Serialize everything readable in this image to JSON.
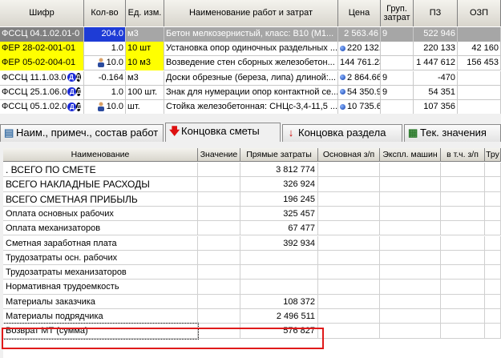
{
  "top_table": {
    "headers": [
      "Шифр",
      "Кол-во",
      "Ед. изм.",
      "Наименование работ и затрат",
      "Цена",
      "Груп. затрат",
      "ПЗ",
      "ОЗП"
    ],
    "rows": [
      {
        "code": "ФССЦ 04.1.02.01-0",
        "qty": "204.0",
        "unit": "м3",
        "name": "Бетон мелкозернистый, класс: В10 (М1...",
        "price": "2 563.46",
        "group": "9",
        "pz": "522 946",
        "ozp": "",
        "style": "selected"
      },
      {
        "code": "ФЕР 28-02-001-01",
        "qty": "1.0",
        "unit": "10 шт",
        "name": "Установка опор одиночных раздельных ...",
        "price": "220 132.71",
        "group": "",
        "pz": "220 133",
        "ozp": "42 160",
        "style": "yellow"
      },
      {
        "code": "ФЕР 05-02-004-01",
        "qty": "10.0",
        "unit": "10 м3",
        "name": "Возведение стен сборных железобетон...",
        "price": "144 761.23",
        "group": "",
        "pz": "1 447 612",
        "ozp": "156 453",
        "style": "yellow"
      },
      {
        "code": "ФССЦ 11.1.03.0",
        "qty": "-0.164",
        "unit": "м3",
        "name": "Доски обрезные (береза, липа) длиной:...",
        "price": "2 864.66",
        "group": "9",
        "pz": "-470",
        "ozp": "",
        "style": "plain"
      },
      {
        "code": "ФССЦ 25.1.06.0",
        "qty": "1.0",
        "unit": "100 шт.",
        "name": "Знак для нумерации опор контактной се...",
        "price": "54 350.99",
        "group": "9",
        "pz": "54 351",
        "ozp": "",
        "style": "plain"
      },
      {
        "code": "ФССЦ 05.1.02.0",
        "qty": "10.0",
        "unit": "шт.",
        "name": "Стойка железобетонная: СНЦс-3,4-11,5 ...",
        "price": "10 735.61",
        "group": "",
        "pz": "107 356",
        "ozp": "",
        "style": "plain"
      }
    ],
    "badge_text": "Д"
  },
  "tabs": [
    {
      "label": "Наим., примеч., состав работ",
      "icon": "notes-icon"
    },
    {
      "label": "Концовка сметы",
      "icon": "arrow-down-icon"
    },
    {
      "label": "Концовка раздела",
      "icon": "section-arrow-icon"
    },
    {
      "label": "Тек. значения",
      "icon": "table-icon"
    }
  ],
  "summary_table": {
    "headers": [
      "Наименование",
      "Значение",
      "Прямые затраты",
      "Основная з/п",
      "Экспл. машин",
      "в т.ч. з/п",
      "Тру"
    ],
    "rows": [
      {
        "name": ". ВСЕГО  ПО  СМЕТЕ",
        "value": "",
        "direct": "3 812 774",
        "big": true
      },
      {
        "name": "ВСЕГО НАКЛАДНЫЕ РАСХОДЫ",
        "value": "",
        "direct": "326 924",
        "big": true
      },
      {
        "name": "ВСЕГО СМЕТНАЯ ПРИБЫЛЬ",
        "value": "",
        "direct": "196 245",
        "big": true
      },
      {
        "name": "Оплата основных рабочих",
        "value": "",
        "direct": "325 457",
        "big": false
      },
      {
        "name": "Оплата механизаторов",
        "value": "",
        "direct": "67 477",
        "big": false
      },
      {
        "name": "Сметная заработная плата",
        "value": "",
        "direct": "392 934",
        "big": false
      },
      {
        "name": "Трудозатраты осн. рабочих",
        "value": "",
        "direct": "",
        "big": false
      },
      {
        "name": "Трудозатраты механизаторов",
        "value": "",
        "direct": "",
        "big": false
      },
      {
        "name": "Нормативная трудоемкость",
        "value": "",
        "direct": "",
        "big": false
      },
      {
        "name": "Материалы заказчика",
        "value": "",
        "direct": "108 372",
        "big": false
      },
      {
        "name": "Материалы подрядчика",
        "value": "",
        "direct": "2 496 511",
        "big": false
      },
      {
        "name": "Возврат МТ (сумма)",
        "value": "",
        "direct": "576 827",
        "big": false
      }
    ]
  },
  "colors": {
    "selected_code_bg": "#808080",
    "selected_qty_bg": "#1e3cd6",
    "yellow_bg": "#ffff00",
    "highlight_border": "#e01a1a"
  }
}
